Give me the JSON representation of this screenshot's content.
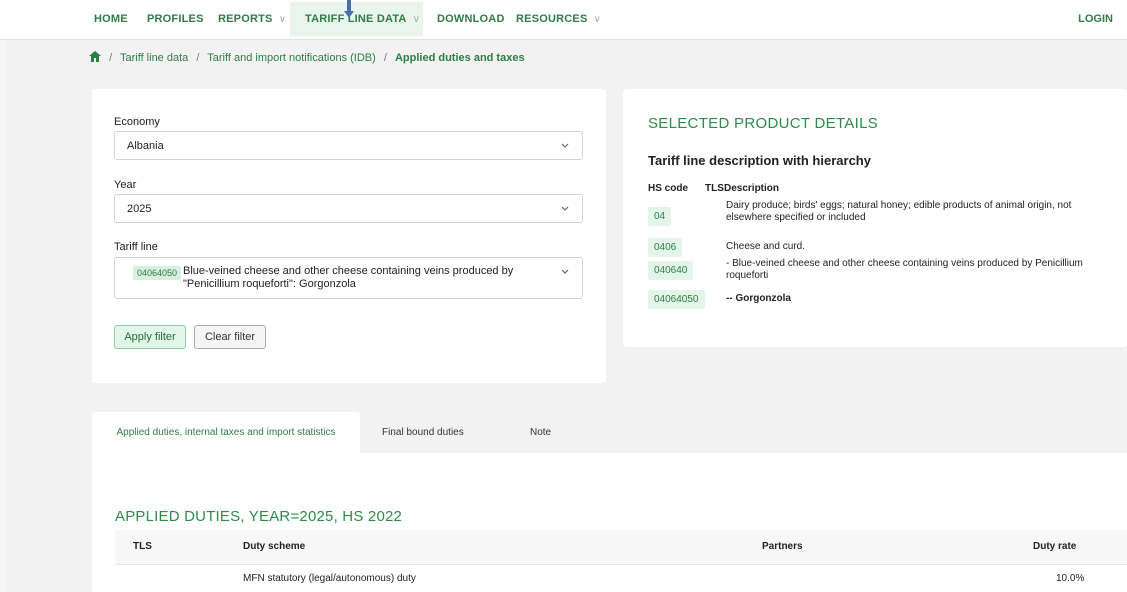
{
  "nav": {
    "items": [
      {
        "label": "HOME",
        "chevron": false
      },
      {
        "label": "PROFILES",
        "chevron": false
      },
      {
        "label": "REPORTS",
        "chevron": true
      },
      {
        "label": "TARIFF LINE DATA",
        "chevron": true
      },
      {
        "label": "DOWNLOAD",
        "chevron": false
      },
      {
        "label": "RESOURCES",
        "chevron": true
      }
    ],
    "login": "LOGIN",
    "active": "TARIFF LINE DATA"
  },
  "breadcrumb": {
    "items": [
      "Tariff line data",
      "Tariff and import notifications (IDB)"
    ],
    "current": "Applied duties and taxes",
    "separator": "/"
  },
  "filters": {
    "economy_label": "Economy",
    "economy_value": "Albania",
    "year_label": "Year",
    "year_value": "2025",
    "tariff_label": "Tariff line",
    "tariff_code": "04064050",
    "tariff_text": "Blue-veined cheese and other cheese containing veins produced by \"Penicillium roqueforti\": Gorgonzola",
    "apply_label": "Apply filter",
    "clear_label": "Clear filter"
  },
  "product": {
    "title": "SELECTED PRODUCT DETAILS",
    "subtitle": "Tariff line description with hierarchy",
    "col_hs": "HS code",
    "col_tls": "TLS",
    "col_desc": "Description",
    "rows": [
      {
        "code": "04",
        "desc": "Dairy produce; birds' eggs; natural honey; edible products of animal origin, not elsewhere specified or included",
        "bold": false
      },
      {
        "code": "0406",
        "desc": "Cheese and curd.",
        "bold": false
      },
      {
        "code": "040640",
        "desc": "- Blue-veined cheese and other cheese containing veins produced by Penicillium roqueforti",
        "bold": false
      },
      {
        "code": "04064050",
        "desc": "-- Gorgonzola",
        "bold": true
      }
    ]
  },
  "tabs": [
    {
      "label": "Applied duties, internal taxes and import statistics",
      "active": true
    },
    {
      "label": "Final bound duties",
      "active": false
    },
    {
      "label": "Note",
      "active": false
    }
  ],
  "duties": {
    "title": "APPLIED DUTIES, YEAR=2025, HS 2022",
    "columns": [
      "TLS",
      "Duty scheme",
      "Partners",
      "Duty rate"
    ],
    "rows": [
      {
        "tls": "",
        "scheme": "MFN statutory (legal/autonomous) duty",
        "partners": "",
        "rate": "10.0%"
      }
    ]
  },
  "colors": {
    "accent": "#2e7d45",
    "accent_light": "#e2f5e8",
    "background": "#f2f2f2"
  }
}
